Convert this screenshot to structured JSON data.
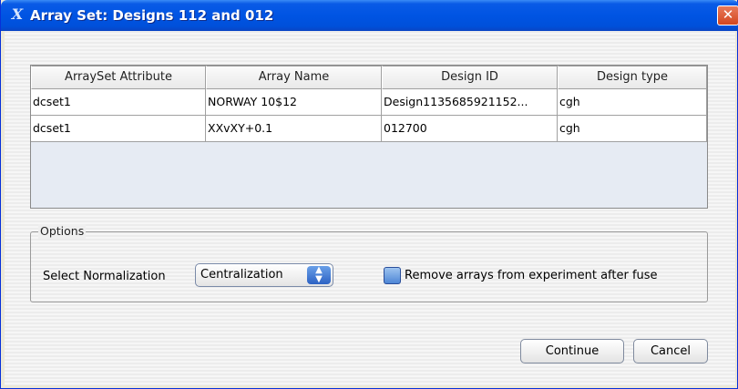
{
  "window": {
    "title": "Array Set: Designs 112 and 012",
    "app_icon": "x-logo-icon",
    "close_glyph": "✕"
  },
  "table": {
    "headers": [
      "ArraySet Attribute",
      "Array Name",
      "Design ID",
      "Design type"
    ],
    "rows": [
      [
        "dcset1",
        "NORWAY 10$12",
        "Design1135685921152...",
        "cgh"
      ],
      [
        "dcset1",
        "XXvXY+0.1",
        "012700",
        "cgh"
      ]
    ]
  },
  "options": {
    "legend": "Options",
    "normalization_label": "Select Normalization",
    "normalization_value": "Centralization",
    "remove_checkbox_label": "Remove arrays from experiment after fuse",
    "remove_checkbox_checked": false
  },
  "buttons": {
    "continue_label": "Continue",
    "cancel_label": "Cancel"
  },
  "colors": {
    "titlebar": "#0054e3",
    "close_button": "#d4461e"
  }
}
